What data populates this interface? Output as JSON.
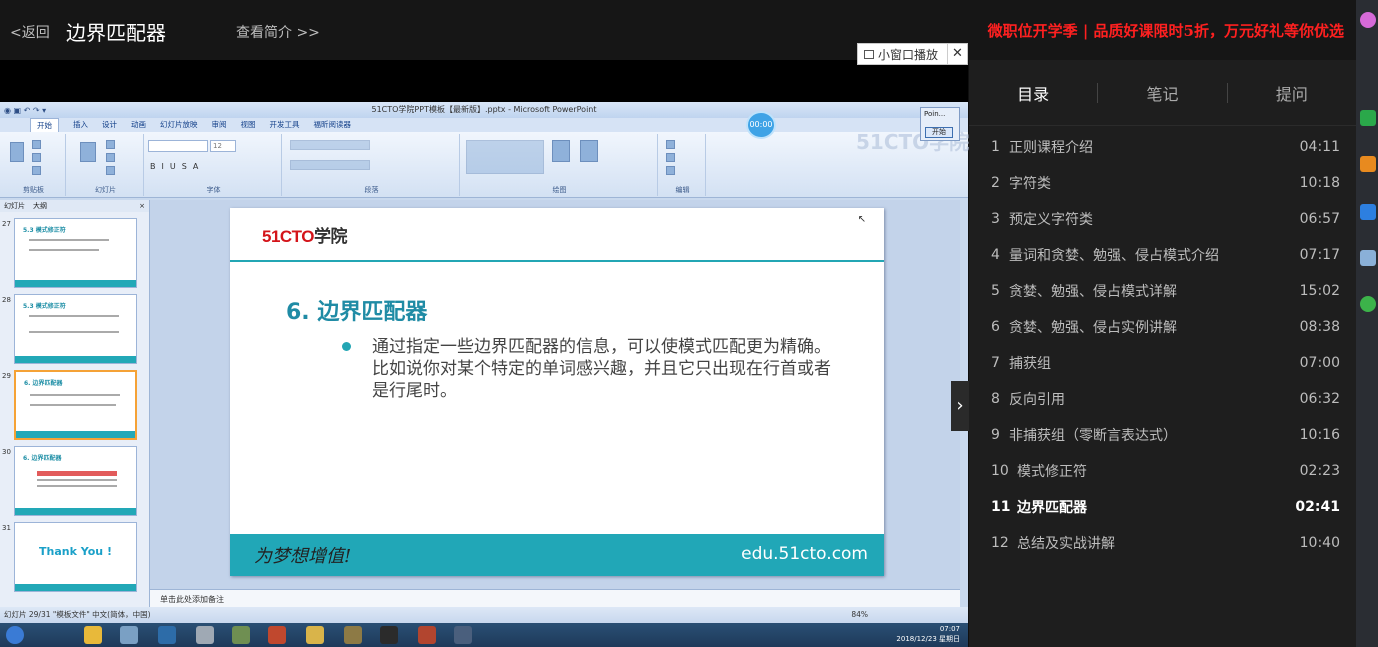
{
  "topbar": {
    "back": "<返回",
    "title": "边界匹配器",
    "intro": "查看简介 >>",
    "promo": "微职位开学季 | 品质好课限时5折，万元好礼等你优选",
    "mini_player": "小窗口播放",
    "close": "✕"
  },
  "ppt": {
    "window_title": "51CTO学院PPT模板【最新版】.pptx - Microsoft PowerPoint",
    "tabs": [
      "开始",
      "插入",
      "设计",
      "动画",
      "幻灯片放映",
      "审阅",
      "视图",
      "开发工具",
      "福昕阅读器"
    ],
    "groups": [
      "剪贴板",
      "幻灯片",
      "字体",
      "段落",
      "绘图",
      "编辑"
    ],
    "font_size": "12",
    "pane_tabs": [
      "幻灯片",
      "大纲"
    ],
    "pane_close": "×",
    "thumbs": [
      {
        "num": "27",
        "title": "5.3 模式修正符"
      },
      {
        "num": "28",
        "title": "5.3 模式修正符"
      },
      {
        "num": "29",
        "title": "6. 边界匹配器"
      },
      {
        "num": "30",
        "title": "6. 边界匹配器"
      },
      {
        "num": "31",
        "title": "Thank You !"
      }
    ],
    "timer": "00:00",
    "watermark": "51CTO学院",
    "popup_title": "Poin...",
    "popup_button": "开始",
    "notes": "单击此处添加备注",
    "status": "幻灯片 29/31    \"模板文件\"    中文(简体，中国)",
    "zoom": "84%",
    "clock_time": "07:07",
    "clock_date": "2018/12/23 星期日"
  },
  "slide": {
    "logo_red": "51CTO",
    "logo_black": "学院",
    "title": "6. 边界匹配器",
    "body_line1": "通过指定一些边界匹配器的信息，可以使模式匹配更为精确。",
    "body_line2": "比如说你对某个特定的单词感兴趣，并且它只出现在行首或者是行尾时。",
    "footer_left": "为梦想增值!",
    "footer_right": "edu.51cto.com"
  },
  "panel": {
    "tabs": [
      "目录",
      "笔记",
      "提问"
    ],
    "chapters": [
      {
        "num": "1",
        "title": "正则课程介绍",
        "duration": "04:11"
      },
      {
        "num": "2",
        "title": "字符类",
        "duration": "10:18"
      },
      {
        "num": "3",
        "title": "预定义字符类",
        "duration": "06:57"
      },
      {
        "num": "4",
        "title": "量词和贪婪、勉强、侵占模式介绍",
        "duration": "07:17"
      },
      {
        "num": "5",
        "title": "贪婪、勉强、侵占模式详解",
        "duration": "15:02"
      },
      {
        "num": "6",
        "title": "贪婪、勉强、侵占实例讲解",
        "duration": "08:38"
      },
      {
        "num": "7",
        "title": "捕获组",
        "duration": "07:00"
      },
      {
        "num": "8",
        "title": "反向引用",
        "duration": "06:32"
      },
      {
        "num": "9",
        "title": "非捕获组（零断言表达式）",
        "duration": "10:16"
      },
      {
        "num": "10",
        "title": "模式修正符",
        "duration": "02:23"
      },
      {
        "num": "11",
        "title": "边界匹配器",
        "duration": "02:41",
        "current": true
      },
      {
        "num": "12",
        "title": "总结及实战讲解",
        "duration": "10:40"
      }
    ]
  },
  "colors": {
    "accent": "#23a6b4",
    "promo": "#ff2020",
    "logo": "#d4141a"
  },
  "icons": [
    "mini-window-icon",
    "close-icon",
    "chevron-right-icon"
  ]
}
